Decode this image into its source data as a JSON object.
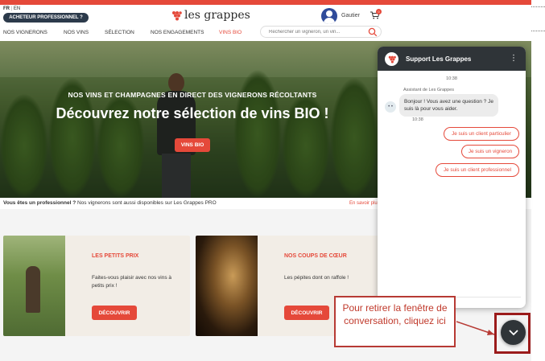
{
  "header": {
    "lang_active": "FR",
    "lang_sep": "|",
    "lang_other": "EN",
    "pro_button": "ACHETEUR PROFESSIONNEL ?",
    "logo_text": "les grappes",
    "user_name": "Gautier",
    "cart_count": "0"
  },
  "nav": {
    "items": [
      "NOS VIGNERONS",
      "NOS VINS",
      "SÉLECTION",
      "NOS ENGAGEMENTS",
      "VINS BIO"
    ],
    "search_placeholder": "Rechercher un vigneron, un vin..."
  },
  "hero": {
    "kicker": "NOS VINS ET CHAMPAGNES EN DIRECT DES VIGNERONS RÉCOLTANTS",
    "title": "Découvrez notre sélection de vins BIO !",
    "button": "VINS BIO"
  },
  "pro_banner": {
    "bold": "Vous êtes un professionnel ?",
    "text": " Nos vignerons sont aussi disponibles sur Les Grappes PRO",
    "link": "En savoir plu"
  },
  "cards": [
    {
      "title": "LES PETITS PRIX",
      "text": "Faites-vous plaisir avec nos vins à petits prix !",
      "button": "DÉCOUVRIR"
    },
    {
      "title": "NOS COUPS DE CŒUR",
      "text": "Les pépites dont on raffole !",
      "button": "DÉCOUVRIR"
    }
  ],
  "chat": {
    "title": "Support Les Grappes",
    "menu": "⋮",
    "time1": "10:38",
    "bot_name": "Assistant de Les Grappes",
    "bot_avatar": "• •",
    "bot_message": "Bonjour ! Vous avez une question ? Je suis là pour vous aider.",
    "time2": "10:38",
    "options": [
      "Je suis un client particulier",
      "Je suis un vigneron",
      "Je suis un client professionnel"
    ]
  },
  "callout": {
    "text": "Pour retirer la fenêtre de conversation, cliquez ici"
  },
  "colors": {
    "accent": "#e5493a",
    "dark": "#2f3438",
    "navy": "#2c3a4b",
    "callout_border": "#b73a34"
  }
}
